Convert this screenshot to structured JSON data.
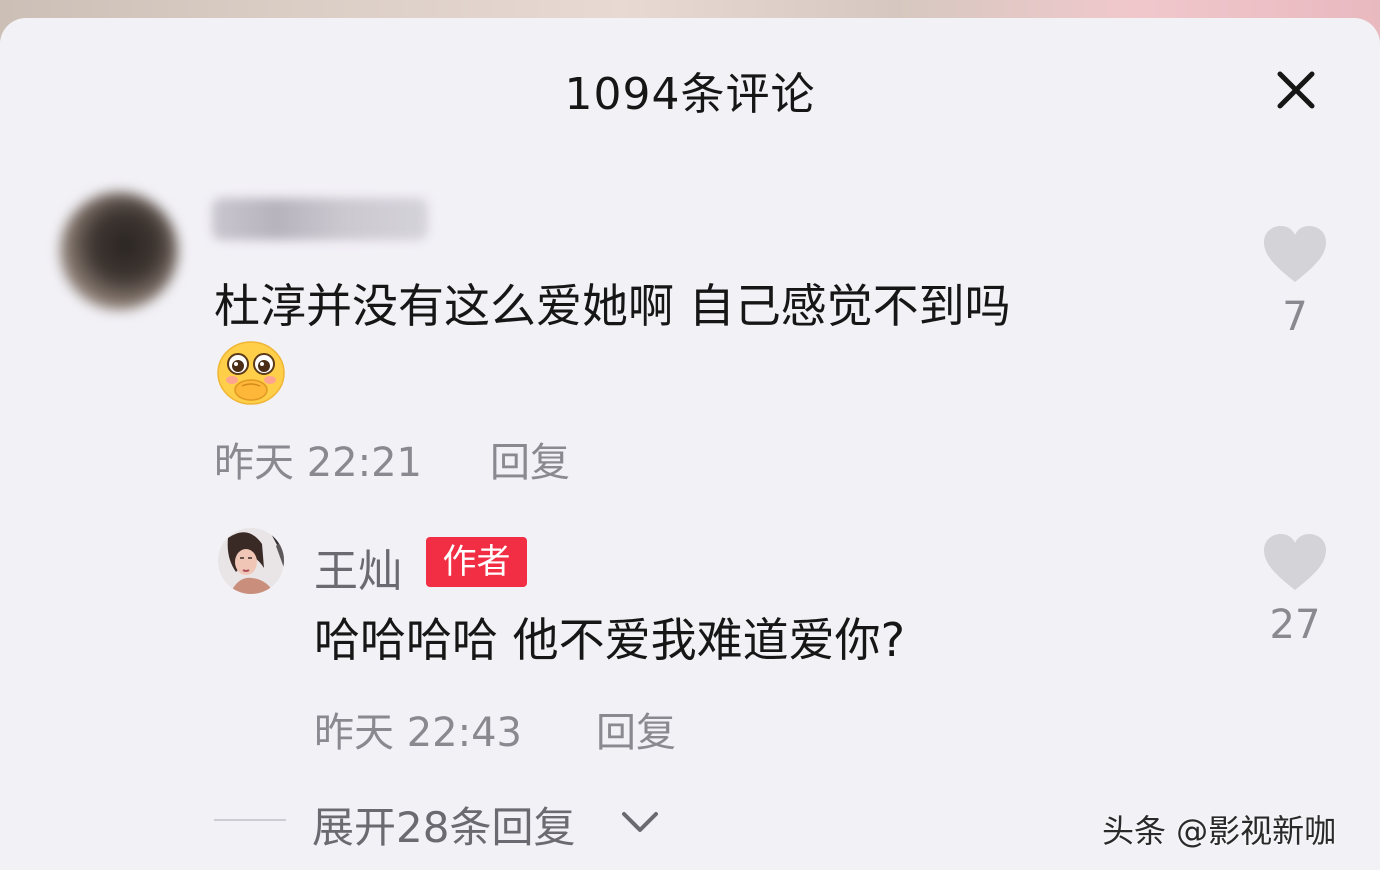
{
  "header": {
    "title": "1094条评论"
  },
  "comment": {
    "text": "杜淳并没有这么爱她啊 自己感觉不到吗",
    "emoji": "pleading-face-emoji",
    "time": "昨天 22:21",
    "reply_label": "回复",
    "likes": "7"
  },
  "reply": {
    "author": "王灿",
    "badge": "作者",
    "text": "哈哈哈哈 他不爱我难道爱你?",
    "time": "昨天 22:43",
    "reply_label": "回复",
    "likes": "27"
  },
  "expand": {
    "label": "展开28条回复"
  },
  "watermark": {
    "text": "头条 @影视新咖"
  },
  "colors": {
    "badge": "#f12e43",
    "sheet_bg": "#f2f1f6",
    "secondary_text": "#8a8990",
    "heart": "#d4d3d8"
  }
}
